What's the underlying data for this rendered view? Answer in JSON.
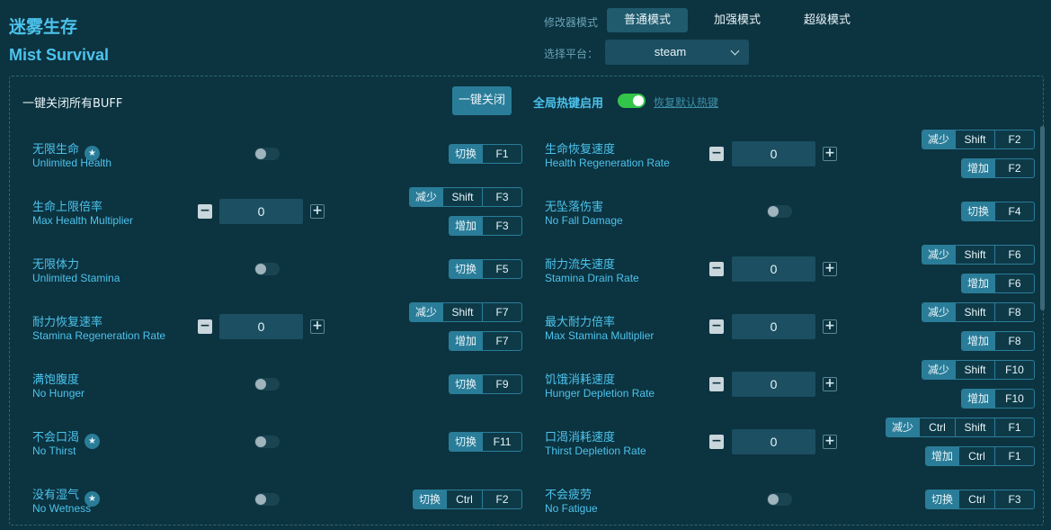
{
  "app": {
    "title_cn": "迷雾生存",
    "title_en": "Mist Survival"
  },
  "modes": {
    "label": "修改器模式",
    "normal": "普通模式",
    "enhanced": "加强模式",
    "super": "超级模式"
  },
  "platform": {
    "label": "选择平台：",
    "value": "steam"
  },
  "buff": {
    "label": "一键关闭所有BUFF",
    "button": "一键关闭"
  },
  "hotkeys": {
    "label": "全局热键启用",
    "enabled": true,
    "restore": "恢复默认热键"
  },
  "actions": {
    "toggle": "切换",
    "decrease": "减少",
    "increase": "增加"
  },
  "left": [
    {
      "cn": "无限生命",
      "en": "Unlimited Health",
      "star": true,
      "keys": [
        "F1"
      ]
    },
    {
      "cn": "生命上限倍率",
      "en": "Max Health Multiplier",
      "value": "0",
      "dec_keys": [
        "Shift",
        "F3"
      ],
      "inc_keys": [
        "F3"
      ]
    },
    {
      "cn": "无限体力",
      "en": "Unlimited Stamina",
      "keys": [
        "F5"
      ]
    },
    {
      "cn": "耐力恢复速率",
      "en": "Stamina Regeneration Rate",
      "value": "0",
      "dec_keys": [
        "Shift",
        "F7"
      ],
      "inc_keys": [
        "F7"
      ]
    },
    {
      "cn": "满饱腹度",
      "en": "No Hunger",
      "keys": [
        "F9"
      ]
    },
    {
      "cn": "不会口渴",
      "en": "No Thirst",
      "star": true,
      "keys": [
        "F11"
      ]
    },
    {
      "cn": "没有湿气",
      "en": "No Wetness",
      "star": true,
      "keys": [
        "Ctrl",
        "F2"
      ]
    }
  ],
  "right": [
    {
      "cn": "生命恢复速度",
      "en": "Health Regeneration Rate",
      "value": "0",
      "dec_keys": [
        "Shift",
        "F2"
      ],
      "inc_keys": [
        "F2"
      ]
    },
    {
      "cn": "无坠落伤害",
      "en": "No Fall Damage",
      "keys": [
        "F4"
      ]
    },
    {
      "cn": "耐力流失速度",
      "en": "Stamina Drain Rate",
      "value": "0",
      "dec_keys": [
        "Shift",
        "F6"
      ],
      "inc_keys": [
        "F6"
      ]
    },
    {
      "cn": "最大耐力倍率",
      "en": "Max Stamina Multiplier",
      "value": "0",
      "dec_keys": [
        "Shift",
        "F8"
      ],
      "inc_keys": [
        "F8"
      ]
    },
    {
      "cn": "饥饿消耗速度",
      "en": "Hunger Depletion Rate",
      "value": "0",
      "dec_keys": [
        "Shift",
        "F10"
      ],
      "inc_keys": [
        "F10"
      ]
    },
    {
      "cn": "口渴消耗速度",
      "en": "Thirst Depletion Rate",
      "value": "0",
      "dec_keys": [
        "Ctrl",
        "Shift",
        "F1"
      ],
      "inc_keys": [
        "Ctrl",
        "F1"
      ]
    },
    {
      "cn": "不会疲劳",
      "en": "No Fatigue",
      "keys": [
        "Ctrl",
        "F3"
      ]
    }
  ],
  "icons": {
    "star": "star-badge-icon",
    "minus": "minus-icon",
    "plus": "plus-icon",
    "dropdown": "chevron-down-icon"
  },
  "colors": {
    "background": "#0c3340",
    "accent": "#4cc3ec",
    "button": "#2a7d99",
    "toggle_on": "#33c44a"
  }
}
